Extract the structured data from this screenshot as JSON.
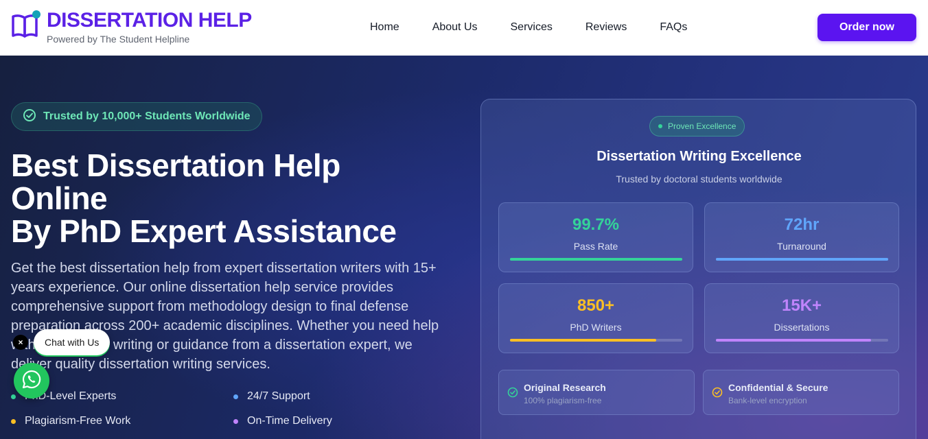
{
  "header": {
    "brand": "DISSERTATION HELP",
    "tagline": "Powered by The Student Helpline",
    "nav": [
      "Home",
      "About Us",
      "Services",
      "Reviews",
      "FAQs"
    ],
    "order_label": "Order now"
  },
  "hero": {
    "badge": "Trusted by 10,000+ Students Worldwide",
    "title_line1": "Best Dissertation Help",
    "title_line2": "Online",
    "title_line3": "By PhD Expert Assistance",
    "description": "Get the best dissertation help from expert dissertation writers with 15+ years experience. Our online dissertation help service provides comprehensive support from methodology design to final defense preparation across 200+ academic disciplines. Whether you need help with dissertation writing or guidance from a dissertation expert, we deliver quality dissertation writing services.",
    "features": [
      {
        "label": "PhD-Level Experts",
        "color": "#34d399"
      },
      {
        "label": "24/7 Support",
        "color": "#60a5fa"
      },
      {
        "label": "Plagiarism-Free Work",
        "color": "#fbbf24"
      },
      {
        "label": "On-Time Delivery",
        "color": "#c084fc"
      }
    ]
  },
  "chat": {
    "label": "Chat with Us",
    "close": "×"
  },
  "card": {
    "pill": "Proven Excellence",
    "title": "Dissertation Writing Excellence",
    "subtitle": "Trusted by doctoral students worldwide",
    "stats": [
      {
        "value": "99.7%",
        "label": "Pass Rate",
        "color": "#34d399",
        "progress": 1.0
      },
      {
        "value": "72hr",
        "label": "Turnaround",
        "color": "#60a5fa",
        "progress": 1.0
      },
      {
        "value": "850+",
        "label": "PhD Writers",
        "color": "#fbbf24",
        "progress": 0.85
      },
      {
        "value": "15K+",
        "label": "Dissertations",
        "color": "#c084fc",
        "progress": 0.9
      }
    ],
    "features": [
      {
        "title": "Original Research",
        "sub": "100% plagiarism-free",
        "color": "#34d399"
      },
      {
        "title": "Confidential & Secure",
        "sub": "Bank-level encryption",
        "color": "#fbbf24"
      }
    ]
  },
  "colors": {
    "accent": "#5b14f0",
    "brand": "#5b21e6"
  }
}
